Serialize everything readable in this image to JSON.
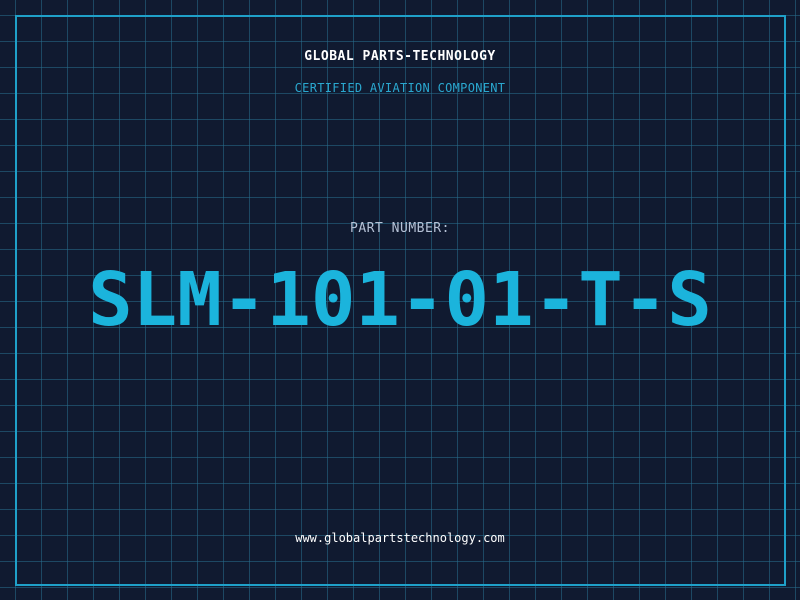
{
  "header": {
    "company": "GLOBAL PARTS-TECHNOLOGY",
    "subtitle": "CERTIFIED AVIATION COMPONENT"
  },
  "main": {
    "label": "PART NUMBER:",
    "part_number": "SLM-101-01-T-S"
  },
  "footer": {
    "url": "www.globalpartstechnology.com"
  },
  "colors": {
    "background": "#101a30",
    "grid": "#286e8c",
    "frame": "#1fa0c8",
    "accent": "#1bb4dc",
    "subtitle": "#2aa8d0",
    "label": "#b6c2d6",
    "text": "#ffffff"
  }
}
